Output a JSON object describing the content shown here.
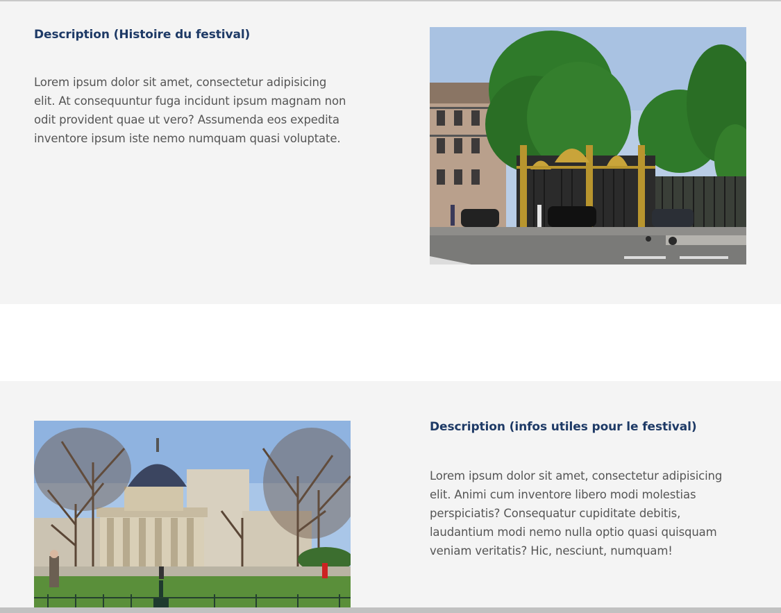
{
  "sections": [
    {
      "title": "Description (Histoire du festival)",
      "text": "Lorem ipsum dolor sit amet, consectetur adipisicing elit. At consequuntur fuga incidunt ipsum magnam non odit provident quae ut vero? Assumenda eos expedita inventore ipsum iste nemo numquam quasi voluptate.",
      "image": "park-gate-photo"
    },
    {
      "title": "Description (infos utiles pour le festival)",
      "text": "Lorem ipsum dolor sit amet, consectetur adipisicing elit. Animi cum inventore libero modi molestias perspiciatis? Consequatur cupiditate debitis, laudantium modi nemo nulla optio quasi quisquam veniam veritatis? Hic, nesciunt, numquam!",
      "image": "rotunda-park-photo"
    }
  ],
  "colors": {
    "section_bg": "#f4f4f4",
    "title": "#1e3a66",
    "body": "#555555"
  }
}
